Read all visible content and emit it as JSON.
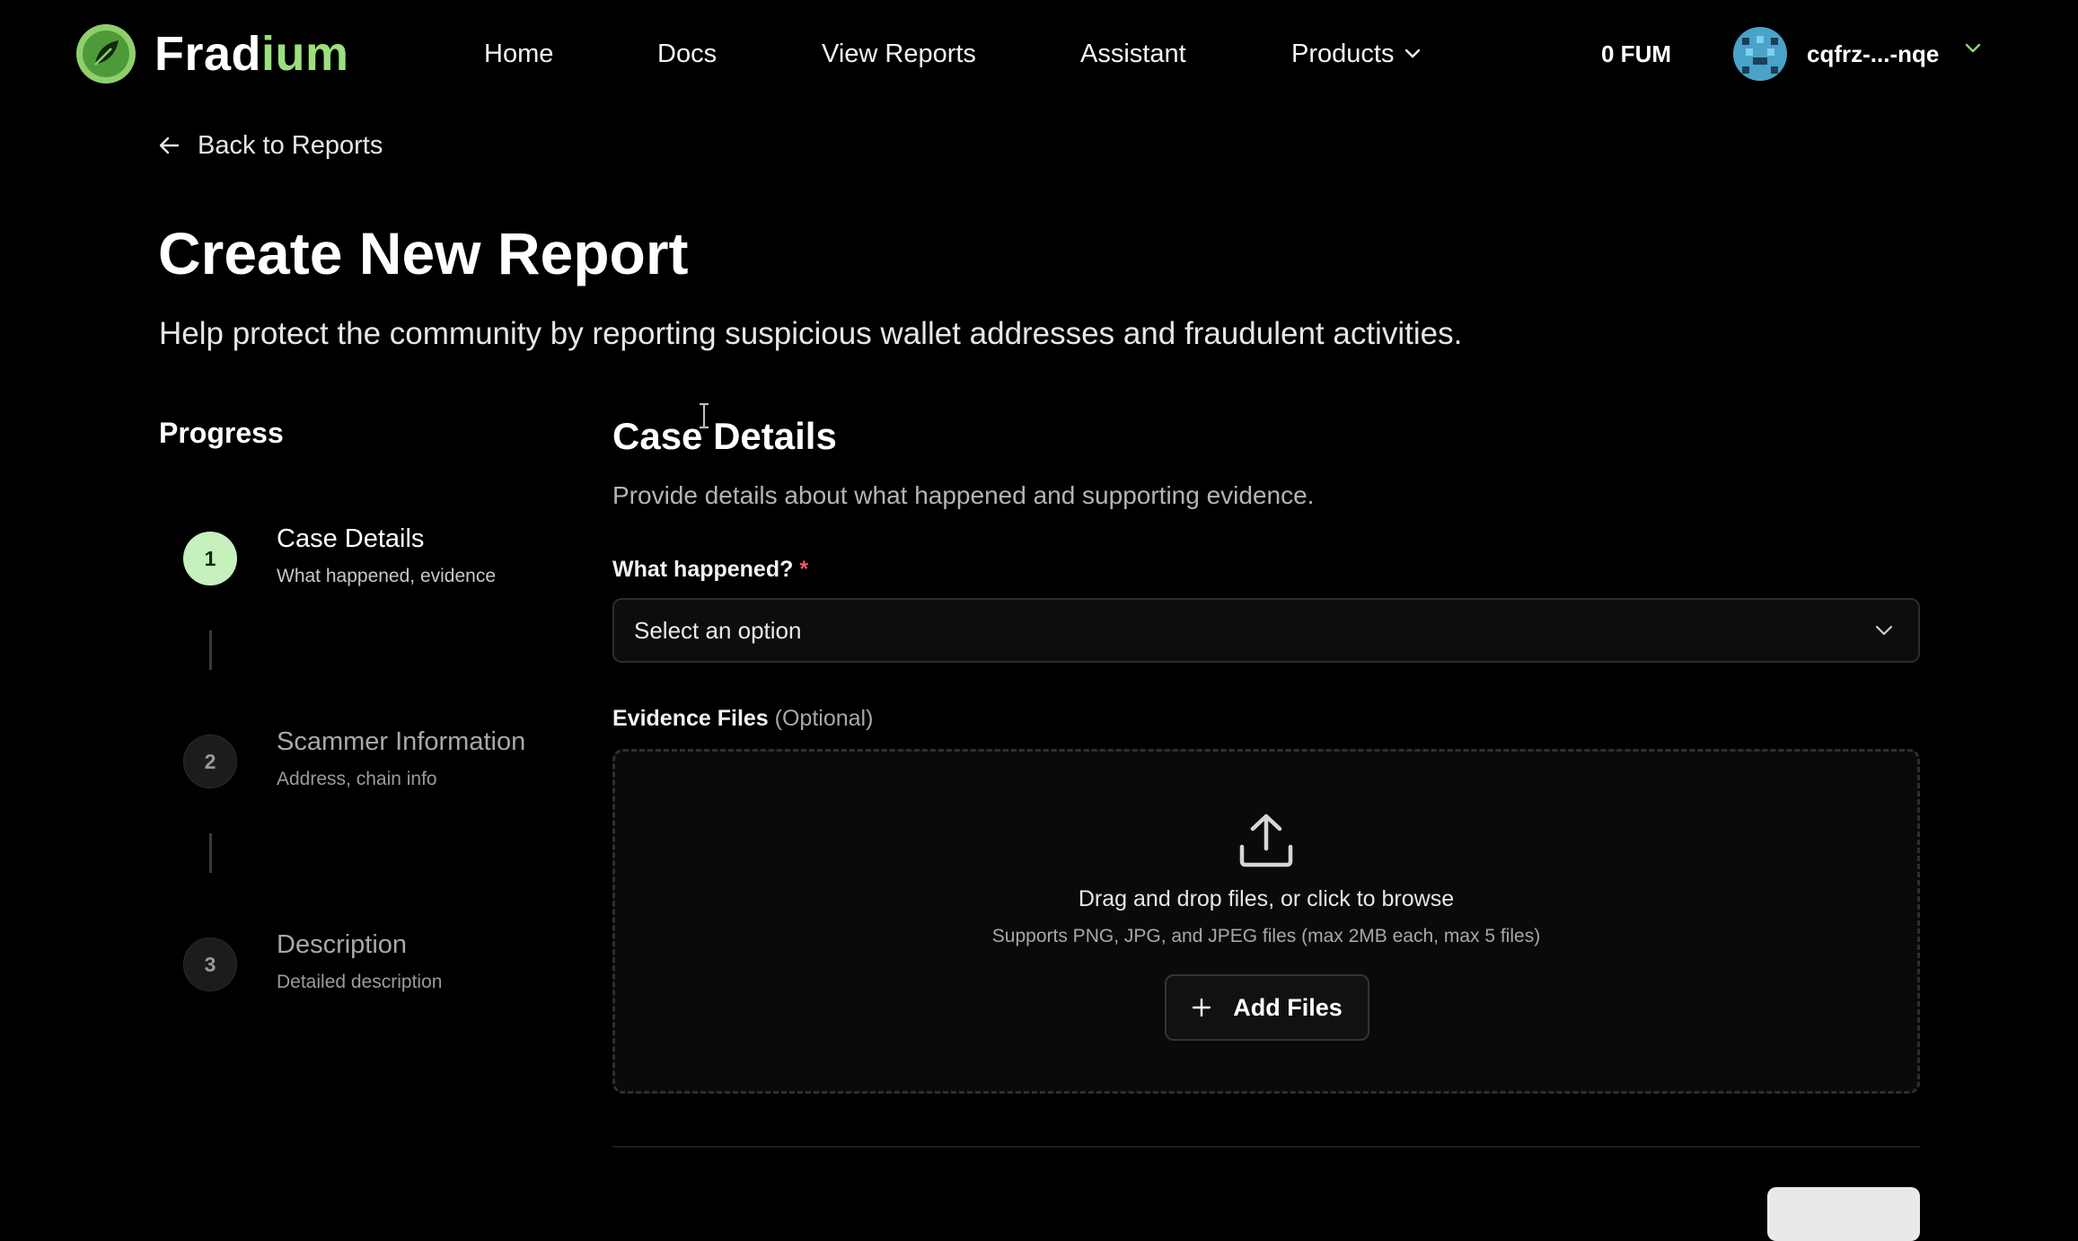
{
  "brand": {
    "name_part1": "Frad",
    "name_part2": "ium",
    "accent_color": "#9be07d",
    "logo_icon": "leaf-logo-icon"
  },
  "nav": {
    "home": "Home",
    "docs": "Docs",
    "view_reports": "View Reports",
    "assistant": "Assistant",
    "products": "Products"
  },
  "account": {
    "balance": "0 FUM",
    "name": "cqfrz-...-nqe"
  },
  "back_link": "Back to Reports",
  "header": {
    "title": "Create New Report",
    "subtitle": "Help protect the community by reporting suspicious wallet addresses and fraudulent activities."
  },
  "progress": {
    "heading": "Progress",
    "steps": [
      {
        "number": "1",
        "title": "Case Details",
        "desc": "What happened, evidence",
        "active": true
      },
      {
        "number": "2",
        "title": "Scammer Information",
        "desc": "Address, chain info",
        "active": false
      },
      {
        "number": "3",
        "title": "Description",
        "desc": "Detailed description",
        "active": false
      }
    ]
  },
  "section": {
    "title": "Case Details",
    "subtitle": "Provide details about what happened and supporting evidence."
  },
  "fields": {
    "what_happened_label": "What happened?",
    "required_mark": "*",
    "what_happened_value": "Select an option",
    "evidence_label": "Evidence Files",
    "evidence_optional": "(Optional)"
  },
  "dropzone": {
    "title": "Drag and drop files, or click to browse",
    "hint": "Supports PNG, JPG, and JPEG files (max 2MB each, max 5 files)",
    "button_label": "Add Files"
  },
  "colors": {
    "background": "#000000",
    "active_step": "#c6f0bc",
    "required": "#ef5a6a"
  }
}
